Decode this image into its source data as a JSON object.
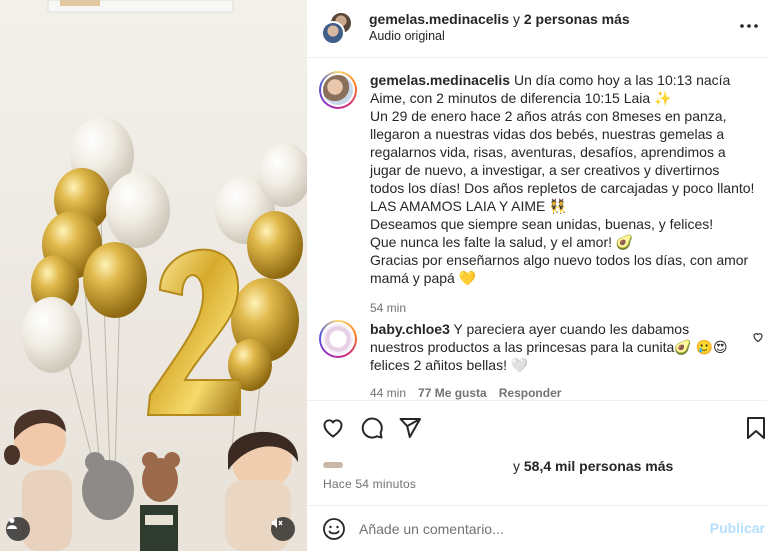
{
  "header": {
    "username": "gemelas.medinacelis",
    "collab_connector": "y",
    "collab_others": "2 personas más",
    "audio_label": "Audio original"
  },
  "caption": {
    "username": "gemelas.medinacelis",
    "lines": [
      "Un día como hoy a las 10:13 nacía Aime, con 2 minutos de diferencia 10:15 Laia ✨",
      "Un 29 de enero hace 2 años atrás con 8meses en panza, llegaron a nuestras vidas dos bebés, nuestras gemelas a regalarnos vida, risas, aventuras, desafíos, aprendimos a jugar de nuevo, a investigar, a ser creativos y divertirnos todos los días! Dos años repletos de carcajadas y poco llanto! LAS AMAMOS LAIA Y AIME 👯",
      "Deseamos que siempre sean unidas, buenas, y felices!",
      "Que nunca les falte la salud, y el amor! 🥑",
      "Gracias por enseñarnos algo nuevo todos los días, con amor mamá y papá 💛"
    ],
    "time": "54 min"
  },
  "comment": {
    "username": "baby.chloe3",
    "text": "Y pareciera ayer cuando les dabamos nuestros productos a las princesas para la cunita🥑 🥲😍 felices 2 añitos bellas! 🤍",
    "time": "44 min",
    "likes": "77 Me gusta",
    "reply": "Responder"
  },
  "likes": {
    "connector": "y",
    "count": "58,4 mil personas más"
  },
  "post_time": "Hace 54 minutos",
  "add_comment": {
    "placeholder": "Añade un comentario...",
    "publish": "Publicar"
  },
  "icons": {
    "more": "more-horizontal-icon",
    "like": "heart-icon",
    "comment": "comment-icon",
    "share": "share-icon",
    "save": "bookmark-icon",
    "emoji": "emoji-icon",
    "user": "user-icon",
    "mute": "mute-icon"
  },
  "colors": {
    "publish_disabled": "#b2dffc",
    "muted_text": "#737373",
    "balloon_gold": "#c9a227",
    "balloon_pearl": "#f4f1ea"
  }
}
